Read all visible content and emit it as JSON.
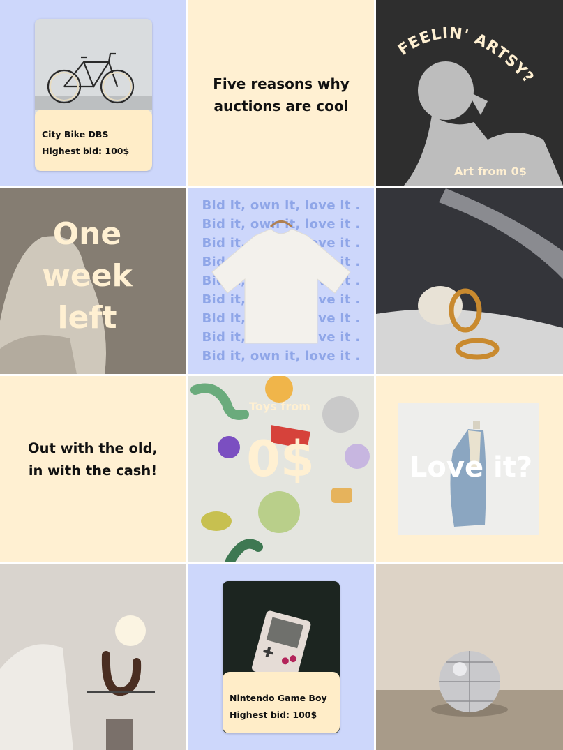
{
  "tiles": {
    "bike_card": {
      "title": "City Bike DBS",
      "bid": "Highest bid: 100$"
    },
    "auctions": {
      "line1": "Five reasons why",
      "line2": "auctions are cool"
    },
    "artsy": {
      "arc": "FEELIN' ARTSY?",
      "sub": "Art from 0$"
    },
    "one_week": {
      "w1": "One",
      "w2": "week",
      "w3": "left"
    },
    "bid_pattern": {
      "line": "Bid it, own it, love it ."
    },
    "out_with_old": {
      "line1": "Out with the old,",
      "line2": "in with the cash!"
    },
    "toys": {
      "line1": "Toys from",
      "price": "0$"
    },
    "love_it": {
      "text": "Love it?"
    },
    "gameboy_card": {
      "title": "Nintendo Game Boy",
      "bid": "Highest bid: 100$"
    }
  },
  "colors": {
    "blue": "#cdd7fb",
    "cream": "#fff0d2",
    "pattern_text": "#8fa6e8"
  }
}
